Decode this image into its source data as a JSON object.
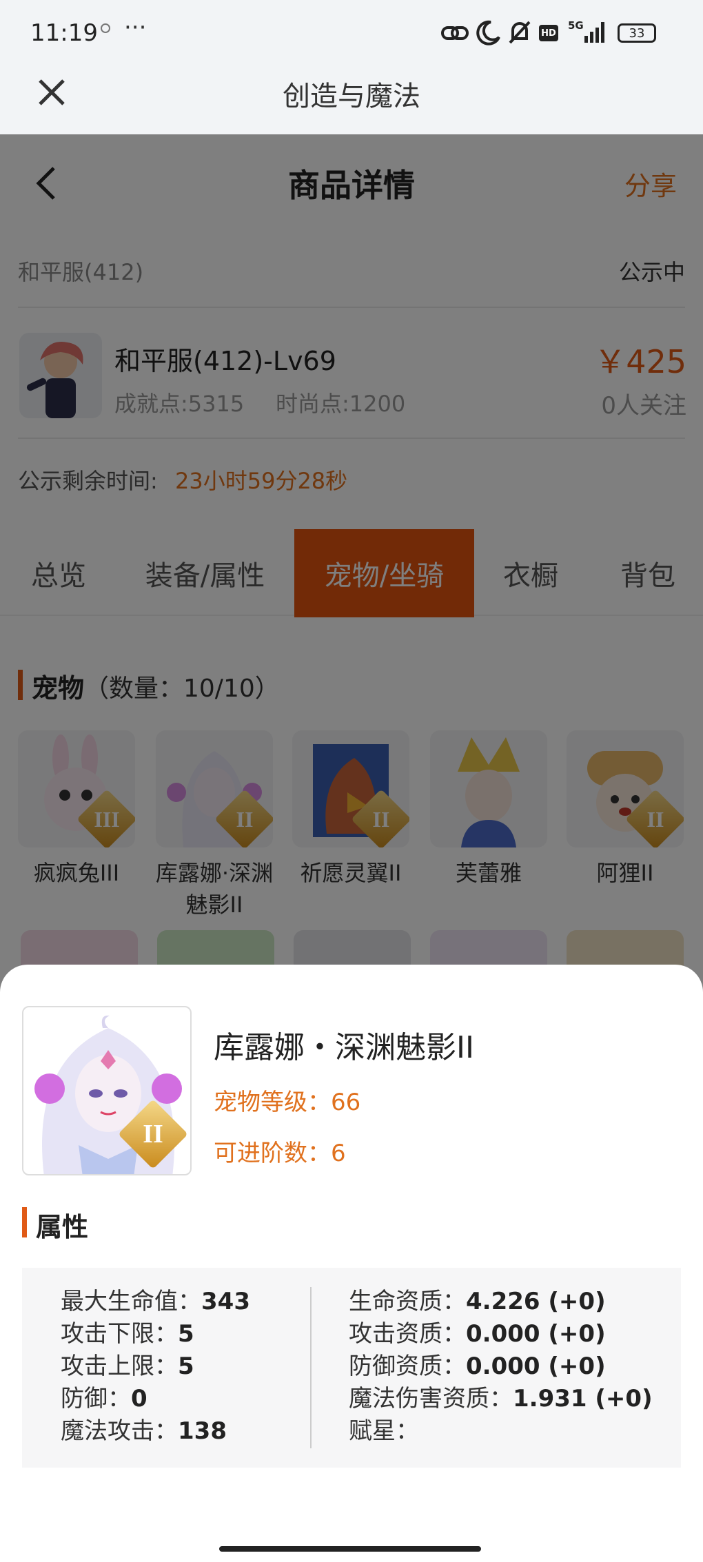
{
  "status_bar": {
    "time": "11:19",
    "dots": "···",
    "battery": "33",
    "signal_label": "5G",
    "hd": "HD"
  },
  "app_header": {
    "title": "创造与魔法"
  },
  "nav": {
    "title": "商品详情",
    "share": "分享"
  },
  "server": {
    "name": "和平服(412)",
    "status": "公示中"
  },
  "character": {
    "name": "和平服(412)-Lv69",
    "achievement": "成就点:5315",
    "fashion": "时尚点:1200",
    "price": "￥425",
    "followers": "0人关注"
  },
  "countdown": {
    "label": "公示剩余时间:",
    "value": "23小时59分28秒"
  },
  "tabs": [
    {
      "label": "总览"
    },
    {
      "label": "装备/属性"
    },
    {
      "label": "宠物/坐骑"
    },
    {
      "label": "衣橱"
    },
    {
      "label": "背包"
    }
  ],
  "pets_section": {
    "title": "宠物",
    "count": "（数量：10/10）"
  },
  "pets": [
    {
      "name": "疯疯兔III",
      "badge": "III"
    },
    {
      "name": "库露娜·深渊魅影II",
      "badge": "II"
    },
    {
      "name": "祈愿灵翼II",
      "badge": "II"
    },
    {
      "name": "芙蕾雅",
      "badge": ""
    },
    {
      "name": "阿狸II",
      "badge": "II"
    }
  ],
  "detail": {
    "name": "库露娜・深渊魅影II",
    "badge": "II",
    "level": "宠物等级：66",
    "advance": "可进阶数：6",
    "attr_title": "属性",
    "left": [
      {
        "label": "最大生命值：",
        "value": "343"
      },
      {
        "label": "攻击下限：",
        "value": "5"
      },
      {
        "label": "攻击上限：",
        "value": "5"
      },
      {
        "label": "防御：",
        "value": "0"
      },
      {
        "label": "魔法攻击：",
        "value": "138"
      }
    ],
    "right": [
      {
        "label": "生命资质：",
        "value": "4.226 (+0)"
      },
      {
        "label": "攻击资质：",
        "value": "0.000 (+0)"
      },
      {
        "label": "防御资质：",
        "value": "0.000 (+0)"
      },
      {
        "label": "魔法伤害资质：",
        "value": "1.931 (+0)"
      },
      {
        "label": "赋星：",
        "value": ""
      }
    ]
  },
  "colors": {
    "accent": "#e05a16",
    "accent_text": "#e0711e",
    "tab_active": "#e5540f"
  }
}
